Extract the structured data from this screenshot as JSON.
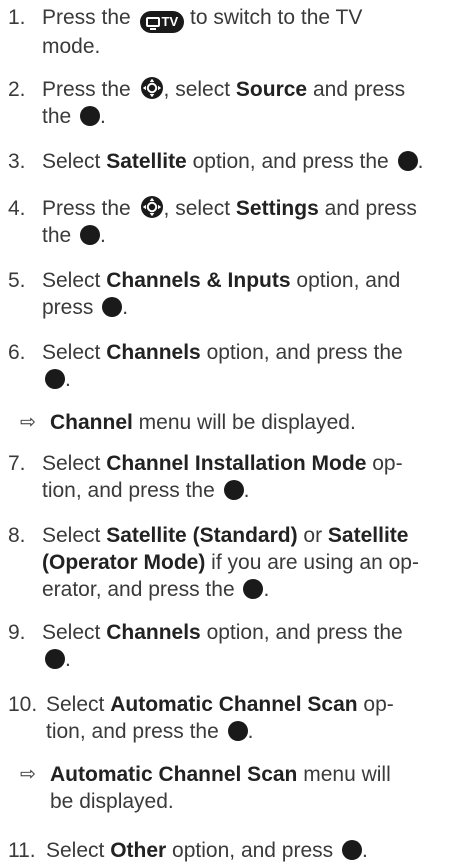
{
  "steps": [
    {
      "num": "1.",
      "lines": [
        [
          "Press the ",
          "{tv}",
          " to switch to the TV"
        ],
        [
          "mode."
        ]
      ]
    },
    {
      "num": "2.",
      "lines": [
        [
          "Press the ",
          "{nav}",
          ", select ",
          "**Source",
          " and press"
        ],
        [
          "the ",
          "{dot}",
          "."
        ]
      ]
    },
    {
      "num": "3.",
      "lines": [
        [
          "Select ",
          "**Satellite",
          " option, and press the ",
          "{dot}",
          "."
        ]
      ]
    },
    {
      "num": "4.",
      "lines": [
        [
          "Press the ",
          "{nav}",
          ", select ",
          "**Settings",
          " and press"
        ],
        [
          "the ",
          "{dot}",
          "."
        ]
      ]
    },
    {
      "num": "5.",
      "lines": [
        [
          "Select ",
          "**Channels & Inputs",
          " option, and"
        ],
        [
          "press ",
          "{dot}",
          "."
        ]
      ]
    },
    {
      "num": "6.",
      "lines": [
        [
          "Select ",
          "**Channels",
          " option, and press the"
        ],
        [
          "{dot}",
          "."
        ]
      ]
    },
    {
      "result": true,
      "lines": [
        [
          "**Channel",
          " menu will be displayed."
        ]
      ]
    },
    {
      "num": "7.",
      "lines": [
        [
          "Select ",
          "**Channel Installation Mode",
          " op-"
        ],
        [
          "tion, and press the ",
          "{dot}",
          "."
        ]
      ]
    },
    {
      "num": "8.",
      "lines": [
        [
          "Select ",
          "**Satellite (Standard)",
          " or ",
          "**Satellite"
        ],
        [
          "**(Operator Mode)",
          " if you are using an op-"
        ],
        [
          "erator, and press the ",
          "{dot}",
          "."
        ]
      ]
    },
    {
      "num": "9.",
      "lines": [
        [
          "Select ",
          "**Channels",
          " option, and press the"
        ],
        [
          "{dot}",
          "."
        ]
      ]
    },
    {
      "num": "10.",
      "lines": [
        [
          "Select ",
          "**Automatic Channel Scan",
          " op-"
        ],
        [
          "tion, and press the ",
          "{dot}",
          "."
        ]
      ]
    },
    {
      "result": true,
      "lines": [
        [
          "**Automatic Channel Scan",
          " menu will"
        ],
        [
          "be displayed."
        ]
      ]
    },
    {
      "num": "11.",
      "lines": [
        [
          "Select ",
          "**Other",
          " option, and press ",
          "{dot}",
          "."
        ]
      ]
    }
  ],
  "icons": {
    "tv_button": "tv-button-icon",
    "nav_button": "navigation-pad-icon",
    "ok_button": "ok-button-icon",
    "result_arrow": "right-arrow-icon"
  },
  "tv_label": "TV",
  "arrow_glyph": "⇨"
}
